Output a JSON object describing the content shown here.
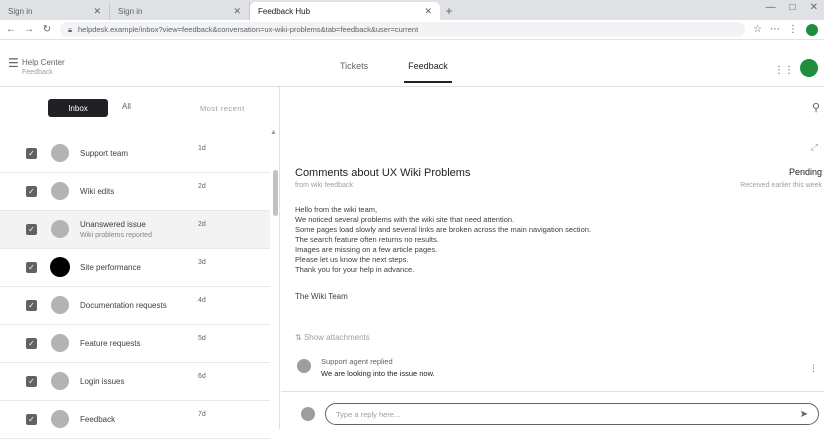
{
  "browser": {
    "tabs": [
      {
        "title": "Sign in",
        "active": false
      },
      {
        "title": "Sign in",
        "active": false
      },
      {
        "title": "Feedback Hub",
        "active": true
      }
    ],
    "new_tab_symbol": "+",
    "window_controls": [
      "—",
      "□",
      "✕"
    ],
    "url": "helpdesk.example/inbox?view=feedback&conversation=ux-wiki-problems&tab=feedback&user=current",
    "icons": [
      "back-icon",
      "forward-icon",
      "reload-icon",
      "star-icon",
      "extensions-icon",
      "profile-icon"
    ]
  },
  "app": {
    "brand": "Help Center",
    "brand_sub": "Feedback",
    "tabs": [
      {
        "label": "Tickets",
        "active": false
      },
      {
        "label": "Feedback",
        "active": true
      }
    ]
  },
  "sidebar": {
    "filter_active": "Inbox",
    "filter_other": "All",
    "sort_label": "Most recent",
    "items": [
      {
        "name": "Support team",
        "sub": "",
        "date": "1d",
        "selected": false,
        "avatar": "gray"
      },
      {
        "name": "Wiki edits",
        "sub": "",
        "date": "2d",
        "selected": false,
        "avatar": "gray"
      },
      {
        "name": "Unanswered issue",
        "sub": "Wiki problems reported",
        "date": "2d",
        "selected": true,
        "avatar": "gray"
      },
      {
        "name": "Site performance",
        "sub": "",
        "date": "3d",
        "selected": false,
        "avatar": "black"
      },
      {
        "name": "Documentation requests",
        "sub": "",
        "date": "4d",
        "selected": false,
        "avatar": "gray"
      },
      {
        "name": "Feature requests",
        "sub": "",
        "date": "5d",
        "selected": false,
        "avatar": "gray"
      },
      {
        "name": "Login issues",
        "sub": "",
        "date": "6d",
        "selected": false,
        "avatar": "gray"
      },
      {
        "name": "Feedback",
        "sub": "",
        "date": "7d",
        "selected": false,
        "avatar": "gray"
      }
    ]
  },
  "conversation": {
    "subject": "Comments about UX Wiki Problems",
    "sender": "from wiki feedback",
    "price": "Pending",
    "date": "Received earlier this week",
    "body": [
      "Hello from the wiki team,",
      "We noticed several problems with the wiki site that need attention.",
      "Some pages load slowly and several links are broken across the main navigation section.",
      "The search feature often returns no results.",
      "Images are missing on a few article pages.",
      "Please let us know the next steps.",
      "Thank you for your help in advance."
    ],
    "signature": "The Wiki Team",
    "attachment_label": "Show attachments",
    "reply": {
      "name": "Support agent replied",
      "text": "We are looking into the issue now."
    },
    "compose_placeholder": "Type a reply here..."
  }
}
